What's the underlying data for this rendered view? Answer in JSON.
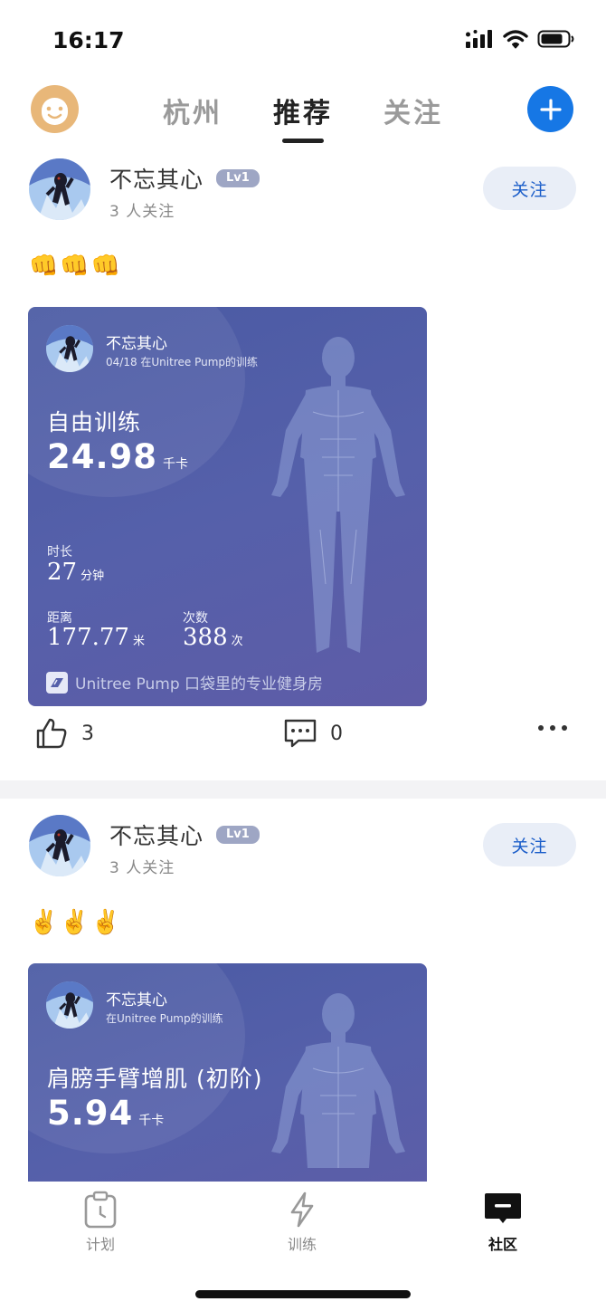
{
  "status_bar": {
    "time": "16:17"
  },
  "top_nav": {
    "tabs": [
      {
        "label": "杭州",
        "active": false
      },
      {
        "label": "推荐",
        "active": true
      },
      {
        "label": "关注",
        "active": false
      }
    ],
    "add_icon": "plus-icon"
  },
  "posts": [
    {
      "user": {
        "name": "不忘其心",
        "level": "Lv1",
        "followers": "3 人关注"
      },
      "follow_label": "关注",
      "text": "👊👊👊",
      "card": {
        "name": "不忘其心",
        "subtitle": "04/18 在Unitree Pump的训练",
        "title": "自由训练",
        "kcal_value": "24.98",
        "kcal_unit": "千卡",
        "duration_label": "时长",
        "duration_value": "27",
        "duration_unit": "分钟",
        "distance_label": "距离",
        "distance_value": "177.77",
        "distance_unit": "米",
        "count_label": "次数",
        "count_value": "388",
        "count_unit": "次",
        "footer": "Unitree Pump 口袋里的专业健身房"
      },
      "likes": "3",
      "comments": "0"
    },
    {
      "user": {
        "name": "不忘其心",
        "level": "Lv1",
        "followers": "3 人关注"
      },
      "follow_label": "关注",
      "text": "✌️✌️✌️",
      "card": {
        "name": "不忘其心",
        "subtitle": "在Unitree Pump的训练",
        "title": "肩膀手臂增肌 (初阶)",
        "kcal_value": "5.94",
        "kcal_unit": "千卡"
      }
    }
  ],
  "bottom_tabs": [
    {
      "label": "计划",
      "icon": "clipboard-clock-icon",
      "active": false
    },
    {
      "label": "训练",
      "icon": "lightning-icon",
      "active": false
    },
    {
      "label": "社区",
      "icon": "chat-bubble-icon",
      "active": true
    }
  ],
  "colors": {
    "accent": "#1677e5",
    "card_bg": "#5560aa",
    "follow_text": "#1a5dc9"
  }
}
